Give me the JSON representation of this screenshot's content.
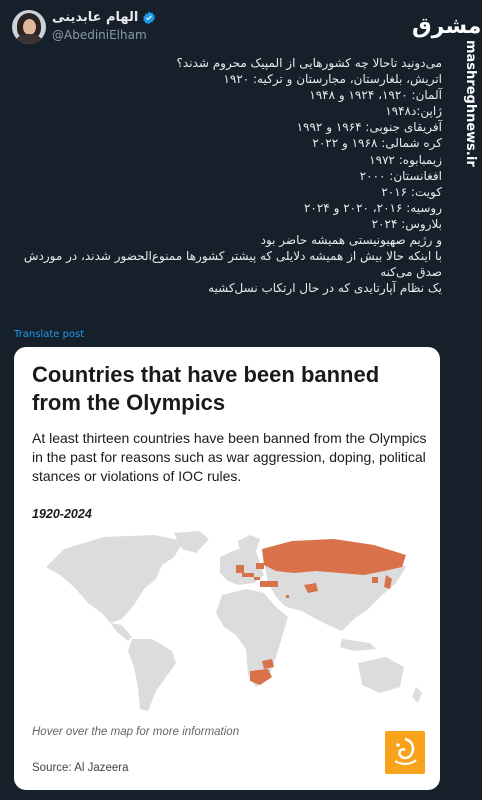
{
  "author": {
    "name": "الهام عابدینی",
    "handle": "@AbediniElham"
  },
  "branding": {
    "logo_text": "مشرق",
    "watermark": "mashreghnews.ir"
  },
  "tweet": {
    "lines": [
      "می‌دونید تاحالا چه کشورهایی از المپیک محروم شدند؟",
      "اتریش، بلغارستان، مجارستان و ترکیه: ۱۹۲۰",
      "آلمان: ۱۹۲۰، ۱۹۲۴ و ۱۹۴۸",
      "ژاپن:د۱۹۴۸",
      "آفریقای جنوبی: ۱۹۶۴ و ۱۹۹۲",
      "کره شمالی: ۱۹۶۸ و ۲۰۲۲",
      "زیمبابوه: ۱۹۷۲",
      "افغانستان: ۲۰۰۰",
      "کویت: ۲۰۱۶",
      "روسیه: ۲۰۱۶، ۲۰۲۰ و ۲۰۲۴",
      "بلاروس: ۲۰۲۴",
      "و رژیم صهیونیستی همیشه حاضر بود",
      "با اینکه حالا بیش از همیشه دلایلی که پیشتر کشورها ممنوع‌الحضور شدند، در موردش صدق می‌کنه",
      "یک نظام آپارتایدی که در حال ارتکاب نسل‌کشیه"
    ],
    "translate_label": "Translate post"
  },
  "card": {
    "title": "Countries that have been banned from the Olympics",
    "subtitle": "At least thirteen countries have been banned from the Olympics in the past for reasons such as war aggression, doping, political stances or violations of IOC rules.",
    "range": "1920-2024",
    "hover_note": "Hover over the map for more information",
    "source": "Source: Al Jazeera",
    "highlight_color": "#d9724a",
    "land_color": "#dcdcdc",
    "banned_regions": [
      "Russia",
      "Belarus",
      "Germany",
      "Austria",
      "Hungary",
      "Bulgaria",
      "Turkey",
      "Japan",
      "North Korea",
      "Kuwait",
      "Afghanistan",
      "Zimbabwe",
      "South Africa"
    ]
  },
  "colors": {
    "background": "#15202b",
    "link": "#1d9bf0",
    "verified": "#1d9bf0",
    "aj_logo": "#f9a21b"
  }
}
